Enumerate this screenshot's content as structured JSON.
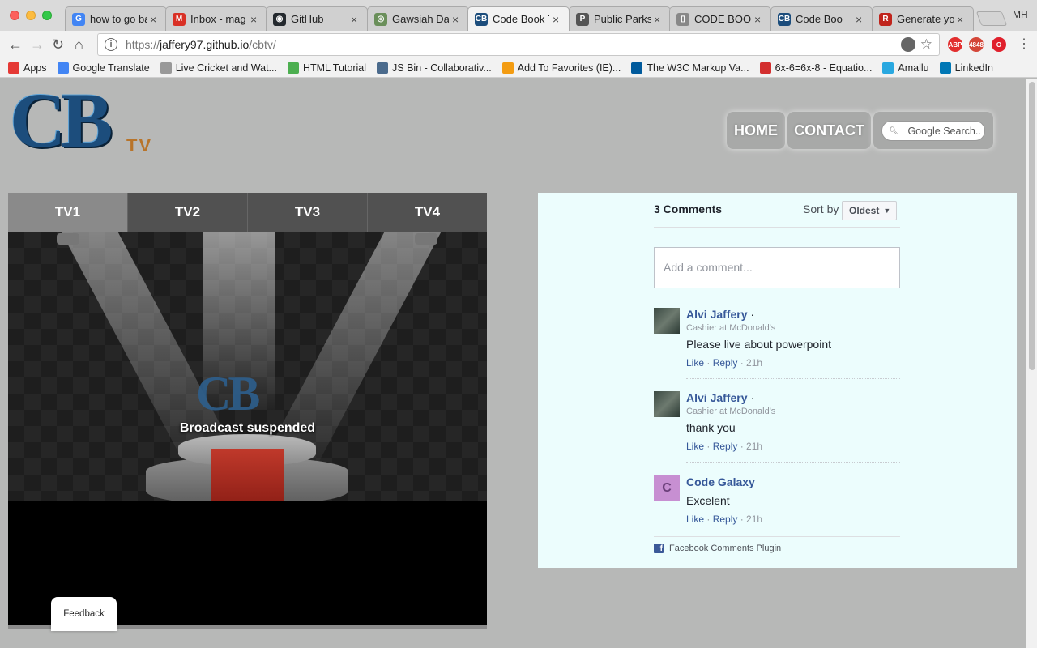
{
  "browser": {
    "tabs": [
      {
        "title": "how to go ba",
        "icon": "google-icon",
        "color": "#4285f4",
        "glyph": "G"
      },
      {
        "title": "Inbox - mag",
        "icon": "gmail-icon",
        "color": "#d93025",
        "glyph": "M"
      },
      {
        "title": "GitHub",
        "icon": "github-icon",
        "color": "#24292e",
        "glyph": "◉"
      },
      {
        "title": "Gawsiah Dar",
        "icon": "page-icon",
        "color": "#6a8f5a",
        "glyph": "◎"
      },
      {
        "title": "Code Book T",
        "icon": "codebook-icon",
        "color": "#1c4d7c",
        "glyph": "CB"
      },
      {
        "title": "Public Parks",
        "icon": "parks-icon",
        "color": "#555555",
        "glyph": "P"
      },
      {
        "title": "CODE BOOK",
        "icon": "document-icon",
        "color": "#888888",
        "glyph": "▯"
      },
      {
        "title": "Code Boo",
        "icon": "codebook-icon",
        "color": "#1c4d7c",
        "glyph": "CB"
      },
      {
        "title": "Generate yo",
        "icon": "generate-icon",
        "color": "#c0241c",
        "glyph": "R"
      }
    ],
    "active_tab": 4,
    "profile": "MH",
    "url": {
      "scheme": "https://",
      "host": "jaffery97.github.io",
      "path": "/cbtv/"
    },
    "extensions": [
      {
        "name": "shield-icon",
        "label": "",
        "color": "#666666"
      },
      {
        "name": "adblock-icon",
        "label": "ABP",
        "color": "#e22e2e"
      },
      {
        "name": "mail-badge-icon",
        "label": "4848",
        "color": "#d44638"
      },
      {
        "name": "opera-icon",
        "label": "O",
        "color": "#e0202c"
      }
    ],
    "bookmarks": [
      {
        "label": "Apps",
        "icon": "apps-icon",
        "color": "#e53935"
      },
      {
        "label": "Google Translate",
        "icon": "translate-icon",
        "color": "#4285f4"
      },
      {
        "label": "Live Cricket and Wat...",
        "icon": "document-icon",
        "color": "#999999"
      },
      {
        "label": "HTML Tutorial",
        "icon": "w3schools-icon",
        "color": "#4caf50"
      },
      {
        "label": "JS Bin - Collaborativ...",
        "icon": "jsbin-icon",
        "color": "#4a6a8c"
      },
      {
        "label": "Add To Favorites (IE)...",
        "icon": "star-icon",
        "color": "#f39c12"
      },
      {
        "label": "The W3C Markup Va...",
        "icon": "w3c-icon",
        "color": "#005a9c"
      },
      {
        "label": "6x-6=6x-8 - Equatio...",
        "icon": "symbolab-icon",
        "color": "#d32f2f"
      },
      {
        "label": "Amallu",
        "icon": "amallu-icon",
        "color": "#29a8e0"
      },
      {
        "label": "LinkedIn",
        "icon": "linkedin-icon",
        "color": "#0077b5"
      }
    ]
  },
  "site": {
    "logo_text": "CB",
    "logo_sub": "TV",
    "nav": {
      "home": "HOME",
      "contact": "CONTACT"
    },
    "search_placeholder": "Google Search.."
  },
  "player": {
    "tabs": [
      "TV1",
      "TV2",
      "TV3",
      "TV4"
    ],
    "active_tab": 0,
    "stage_logo": "CB",
    "status": "Broadcast suspended"
  },
  "feedback_label": "Feedback",
  "comments": {
    "count_label": "3 Comments",
    "sort_label": "Sort by",
    "sort_value": "Oldest",
    "input_placeholder": "Add a comment...",
    "items": [
      {
        "name": "Alvi Jaffery",
        "role": "Cashier at McDonald's",
        "text": "Please live about powerpoint",
        "like": "Like",
        "reply": "Reply",
        "time": "21h",
        "avatar": "photo"
      },
      {
        "name": "Alvi Jaffery",
        "role": "Cashier at McDonald's",
        "text": "thank you",
        "like": "Like",
        "reply": "Reply",
        "time": "21h",
        "avatar": "photo"
      },
      {
        "name": "Code Galaxy",
        "role": "",
        "text": "Excelent",
        "like": "Like",
        "reply": "Reply",
        "time": "21h",
        "avatar": "C"
      }
    ],
    "footer": "Facebook Comments Plugin"
  }
}
